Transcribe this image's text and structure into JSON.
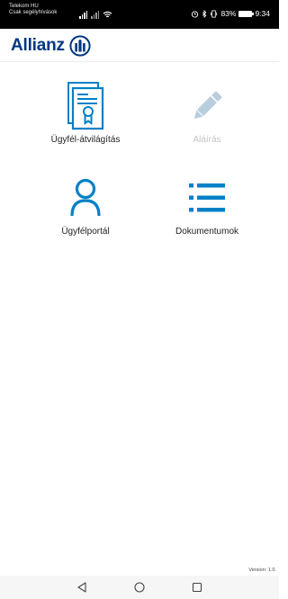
{
  "status_bar": {
    "carrier_line1": "Telekom HU",
    "carrier_line2": "Csak segélyhívások",
    "battery": "83%",
    "time": "9:34"
  },
  "header": {
    "logo_text": "Allianz"
  },
  "menu": {
    "tiles": [
      {
        "label": "Ügyfél-átvilágítás",
        "icon": "certificate-document-icon",
        "enabled": true
      },
      {
        "label": "Aláírás",
        "icon": "pencil-icon",
        "enabled": false
      },
      {
        "label": "Ügyfélportál",
        "icon": "user-icon",
        "enabled": true
      },
      {
        "label": "Dokumentumok",
        "icon": "list-icon",
        "enabled": true
      }
    ]
  },
  "footer": {
    "version": "Version: 1.0."
  },
  "colors": {
    "brand": "#003781",
    "icon_blue": "#0081c6",
    "disabled": "#b8cedd"
  }
}
